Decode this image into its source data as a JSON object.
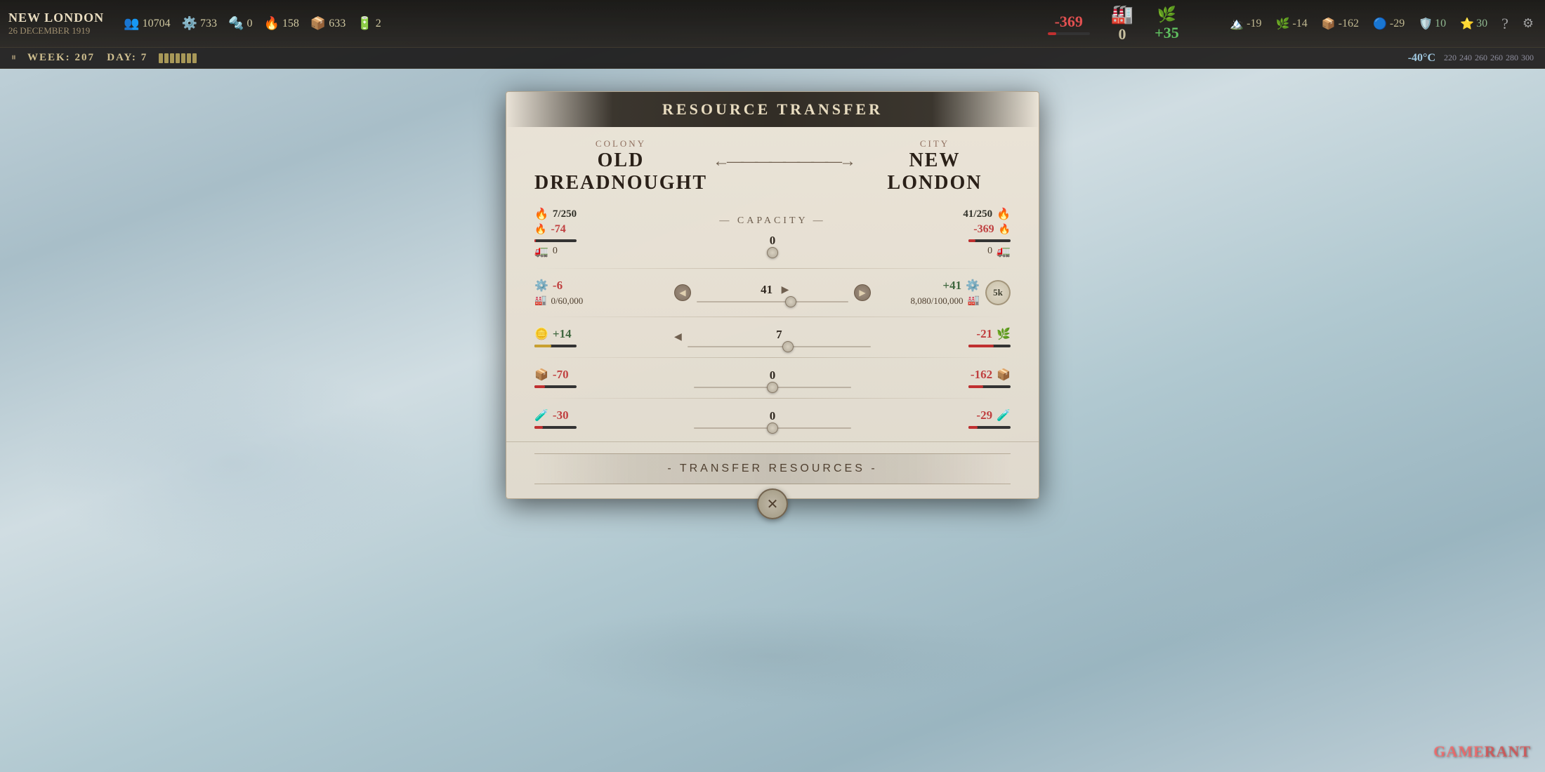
{
  "hud": {
    "city_name": "NEW LONDON",
    "date": "26 DECEMBER 1919",
    "week": "207",
    "day": "7",
    "resources": [
      {
        "icon": "👥",
        "value": "10704"
      },
      {
        "icon": "⚙️",
        "value": "733"
      },
      {
        "icon": "🔩",
        "value": "0"
      },
      {
        "icon": "🔥",
        "value": "158"
      },
      {
        "icon": "📦",
        "value": "633"
      },
      {
        "icon": "🔋",
        "value": "2"
      }
    ],
    "main_resource": {
      "heat_value": "-369",
      "heat_bar_pct": 20,
      "work_value": "0",
      "food_value": "+35"
    },
    "right_resources": [
      {
        "icon": "🏔️",
        "value": "-19"
      },
      {
        "icon": "🌿",
        "value": "-14"
      },
      {
        "icon": "📦",
        "value": "-162"
      },
      {
        "icon": "🔵",
        "value": "-29"
      }
    ],
    "shield_value": "10",
    "star_value": "30",
    "temperature": "-40°C",
    "temp_bar_values": "220 240 260 260 260 280 300"
  },
  "modal": {
    "title": "RESOURCE TRANSFER",
    "colony_label": "COLONY",
    "colony_name": "OLD DREADNOUGHT",
    "city_label": "CITY",
    "city_name": "NEW LONDON",
    "capacity_label": "— CAPACITY —",
    "rows": [
      {
        "id": "heat",
        "icon": "🔥",
        "left_capacity": "7/250",
        "left_rate": "-74",
        "left_rate_class": "negative",
        "left_storage": "0",
        "center_value": "0",
        "center_pct": 50,
        "right_capacity": "41/250",
        "right_rate": "-369",
        "right_rate_class": "negative",
        "right_storage": "0",
        "has_capacity": true
      },
      {
        "id": "steam",
        "icon": "⚙️",
        "left_rate": "-6",
        "left_rate_class": "negative",
        "left_storage": "0/60,000",
        "center_value": "41",
        "center_pct": 62,
        "right_rate": "+41",
        "right_rate_class": "positive",
        "right_storage": "8,080/100,000",
        "has_badge": true,
        "badge_label": "5k",
        "has_capacity": false
      },
      {
        "id": "food",
        "icon": "🌿",
        "left_rate": "+14",
        "left_rate_class": "positive",
        "left_bar_yellow": true,
        "center_value": "7",
        "center_pct": 55,
        "right_rate": "-21",
        "right_rate_class": "negative",
        "has_capacity": false
      },
      {
        "id": "materials",
        "icon": "📦",
        "left_rate": "-70",
        "left_rate_class": "negative",
        "center_value": "0",
        "center_pct": 50,
        "right_rate": "-162",
        "right_rate_class": "negative",
        "has_capacity": false
      },
      {
        "id": "medicine",
        "icon": "🔵",
        "left_rate": "-30",
        "left_rate_class": "negative",
        "center_value": "0",
        "center_pct": 50,
        "right_rate": "-29",
        "right_rate_class": "negative",
        "has_capacity": false
      }
    ],
    "transfer_btn_label": "- TRANSFER RESOURCES -",
    "close_btn_label": "✕"
  },
  "watermark": {
    "text1": "GAME",
    "text2": "RANT"
  }
}
